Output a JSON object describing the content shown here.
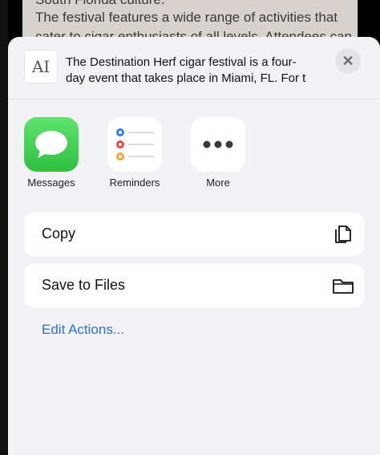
{
  "background_document": {
    "lines": [
      "South Florida culture.",
      "The festival features a wide range of activities that",
      "cater to cigar enthusiasts of all levels. Attendees can"
    ]
  },
  "share_sheet": {
    "preview_icon_label": "AI",
    "preview_text_line1": "The Destination Herf cigar festival is a four-",
    "preview_text_line2": "day event that takes place in Miami, FL. For t...",
    "close_label": "✕",
    "apps": [
      {
        "label": "Messages",
        "icon": "messages-icon"
      },
      {
        "label": "Reminders",
        "icon": "reminders-icon"
      },
      {
        "label": "More",
        "icon": "more-icon"
      }
    ],
    "actions": [
      {
        "label": "Copy",
        "icon": "copy-icon"
      },
      {
        "label": "Save to Files",
        "icon": "folder-icon"
      }
    ],
    "edit_actions_label": "Edit Actions..."
  },
  "colors": {
    "accent": "#2a6fdb",
    "messages_green": "#34c759",
    "sheet_bg": "#f2f2f7"
  }
}
